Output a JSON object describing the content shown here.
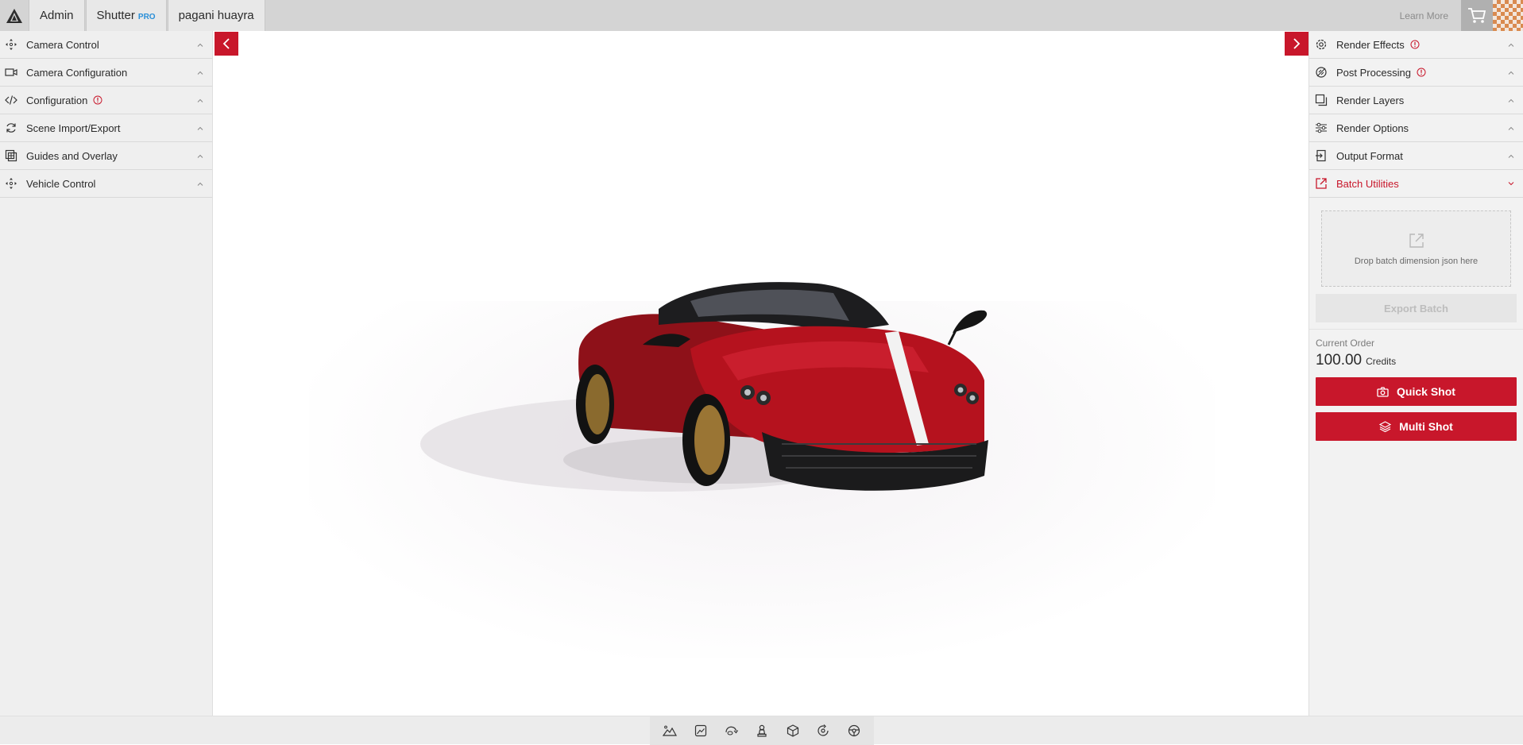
{
  "topbar": {
    "tabs": [
      {
        "label": "Admin"
      },
      {
        "label": "Shutter",
        "badge": "PRO"
      },
      {
        "label": "pagani huayra"
      }
    ],
    "learn_more": "Learn More"
  },
  "left_panel": {
    "items": [
      {
        "label": "Camera Control",
        "icon": "move-icon"
      },
      {
        "label": "Camera Configuration",
        "icon": "video-camera-icon"
      },
      {
        "label": "Configuration",
        "icon": "code-icon",
        "has_info": true
      },
      {
        "label": "Scene Import/Export",
        "icon": "sync-icon"
      },
      {
        "label": "Guides and Overlay",
        "icon": "layers-grid-icon"
      },
      {
        "label": "Vehicle Control",
        "icon": "move-icon"
      }
    ]
  },
  "right_panel": {
    "items": [
      {
        "label": "Render Effects",
        "icon": "gear-icon",
        "has_info": true
      },
      {
        "label": "Post Processing",
        "icon": "palette-icon",
        "has_info": true
      },
      {
        "label": "Render Layers",
        "icon": "layers-icon"
      },
      {
        "label": "Render Options",
        "icon": "sliders-icon"
      },
      {
        "label": "Output Format",
        "icon": "file-export-icon"
      },
      {
        "label": "Batch Utilities",
        "icon": "external-link-icon",
        "active": true
      }
    ],
    "dropzone_text": "Drop batch dimension json here",
    "export_batch": "Export Batch",
    "current_order_label": "Current Order",
    "credits_amount": "100.00",
    "credits_unit": "Credits",
    "quick_shot": "Quick Shot",
    "multi_shot": "Multi Shot"
  },
  "colors": {
    "accent": "#c8172b",
    "pro_badge": "#2a8fd8"
  },
  "bottom_toolbar": {
    "tools": [
      "landscape-icon",
      "image-frame-icon",
      "rotate-icon",
      "pawn-icon",
      "cube-icon",
      "orbit-icon",
      "steering-wheel-icon"
    ]
  }
}
